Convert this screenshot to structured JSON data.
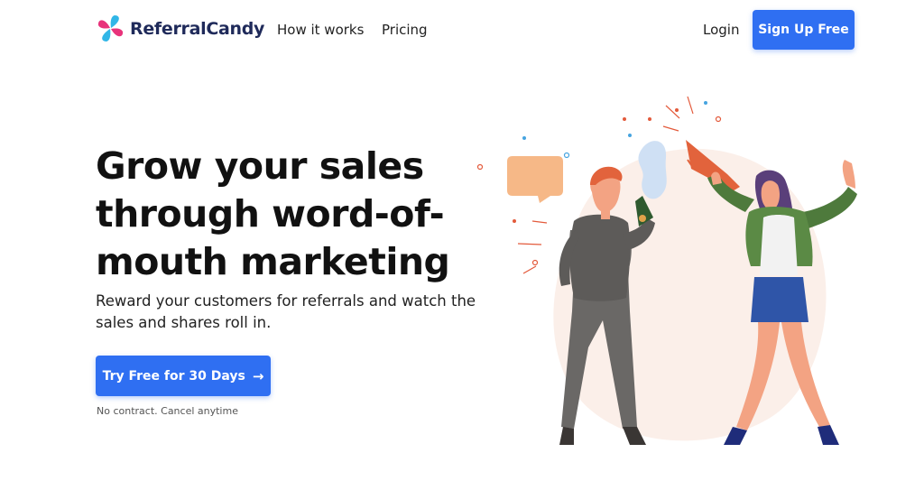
{
  "nav": {
    "brand": "ReferralCandy",
    "links": [
      "How it works",
      "Pricing"
    ],
    "login": "Login",
    "signup": "Sign Up Free"
  },
  "hero": {
    "title": "Grow your sales through word-of-mouth marketing",
    "subtitle": "Reward your customers for referrals and watch the sales and shares roll in.",
    "cta": "Try Free for 30 Days",
    "cta_icon": "arrow-right-icon",
    "note": "No contract. Cancel anytime"
  },
  "colors": {
    "accent": "#2f6ff2",
    "brand_text": "#1f2a5a",
    "logo_pink": "#e8337b",
    "logo_blue": "#31b6e7"
  }
}
